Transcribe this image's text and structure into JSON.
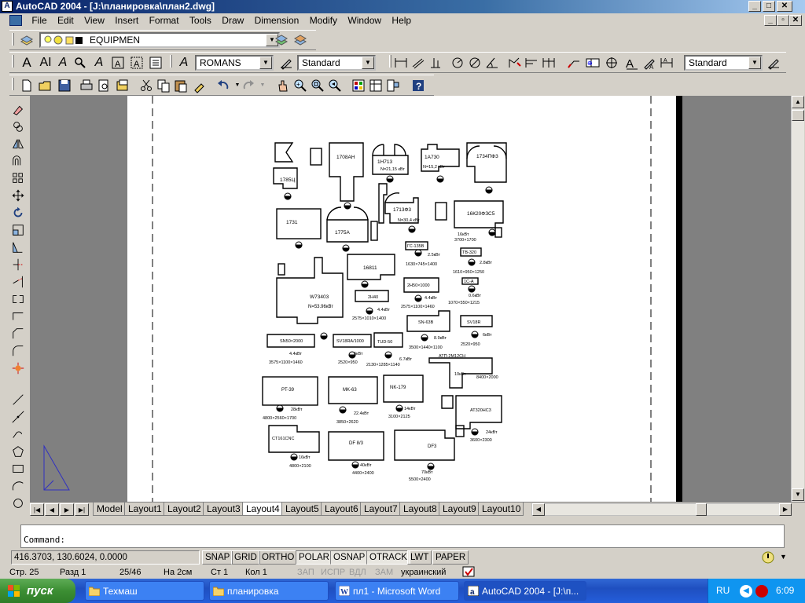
{
  "window": {
    "title": "AutoCAD 2004 - [J:\\планировка\\план2.dwg]",
    "app_icon": "autocad-icon",
    "doc_icon": "drawing-doc-icon"
  },
  "menu": [
    "File",
    "Edit",
    "View",
    "Insert",
    "Format",
    "Tools",
    "Draw",
    "Dimension",
    "Modify",
    "Window",
    "Help"
  ],
  "layers_toolbar": {
    "current_layer": "EQUIPMEN"
  },
  "styles_toolbar": {
    "text_font": "ROMANS",
    "text_style": "Standard",
    "dim_style": "Standard"
  },
  "drawing": {
    "labels": {
      "m1": "1708АН",
      "m2": "1H713",
      "m2p": "N=21,15 кВт",
      "m3": "1А730",
      "m3p": "N=15,2 кВт",
      "m4": "1734ПФ3",
      "m5": "1785Ц",
      "m6": "1731",
      "m7": "1775А",
      "m8": "1713Ф3",
      "m8p": "N=30,4 кВт",
      "m9": "16К20ФЗС5",
      "m9p": "16кВт",
      "m9d": "3700×1700",
      "m10": "ГС-135В",
      "m10p": "2.5кВт",
      "m10d": "1630×745×1400",
      "m11": "ТВ-320",
      "m11p": "2.8кВт",
      "m11d": "1610×950×1250",
      "m12": "1С-А",
      "m12p": "0.6кВт",
      "m12d": "1070×550×1215",
      "m13": "16811",
      "m14": "W73403",
      "m14p": "N=53.96кВт",
      "m15": "2Н40",
      "m15p": "4.4кВт",
      "m15d": "2575×1010×1400",
      "m16": "2Н50×1000",
      "m16p": "4.4кВт",
      "m16d": "2575×1100×1460",
      "m17": "SN-63В",
      "m17p": "8.9кВт",
      "m17d": "3500×1440×1100",
      "m18": "SV18R",
      "m18p": "6кВт",
      "m18d": "2520×950",
      "m19": "SN50×2000",
      "m19p": "4.4кВт",
      "m19d": "3575×1100×1460",
      "m20": "SV18RA/1000",
      "m20p": "6кВт",
      "m20d": "2520×950",
      "m21": "TUD-50",
      "m21p": "6.7кВт",
      "m21d": "2130×1285×1140",
      "m22": "АТП-2М12СН",
      "m22p": "10кВт",
      "m22d": "8400×2000",
      "m23": "PT-39",
      "m23p": "28кВт",
      "m23d": "4800×2560×1700",
      "m24": "MK-63",
      "m24p": "22.4кВт",
      "m24d": "3850×2620",
      "m25": "NK-179",
      "m25p": "14кВт",
      "m25d": "3100×2125",
      "m26": "АТ320НС3",
      "m26p": "24кВт",
      "m26d": "3600×2300",
      "m27": "CT161CNC",
      "m27p": "16кВт",
      "m27d": "4800×2100",
      "m28": "DF 8/3",
      "m28p": "40кВт",
      "m28d": "4400×2400",
      "m29": "DF3",
      "m29p": "70кВт",
      "m29d": "5500×2400"
    }
  },
  "layout_tabs": [
    "Model",
    "Layout1",
    "Layout2",
    "Layout3",
    "Layout4",
    "Layout5",
    "Layout6",
    "Layout7",
    "Layout8",
    "Layout9",
    "Layout10"
  ],
  "active_tab": "Layout4",
  "command": {
    "prompt": "Command:"
  },
  "status": {
    "coords": "416.3703, 130.6024, 0.0000",
    "toggles": [
      "SNAP",
      "GRID",
      "ORTHO",
      "POLAR",
      "OSNAP",
      "OTRACK",
      "LWT",
      "PAPER"
    ]
  },
  "word_status": {
    "page": "Стр. 25",
    "section": "Разд 1",
    "pages": "25/46",
    "at": "На 2см",
    "line": "Ст 1",
    "col": "Кол 1",
    "rec": "ЗАП",
    "trk": "ИСПР",
    "ext": "ВДЛ",
    "ovr": "ЗАМ",
    "lang": "украинский"
  },
  "taskbar": {
    "start": "пуск",
    "tasks": [
      "Техмаш",
      "планировка",
      "пл1 - Microsoft Word",
      "AutoCAD 2004 - [J:\\п..."
    ],
    "lang": "RU",
    "clock": "6:09"
  }
}
